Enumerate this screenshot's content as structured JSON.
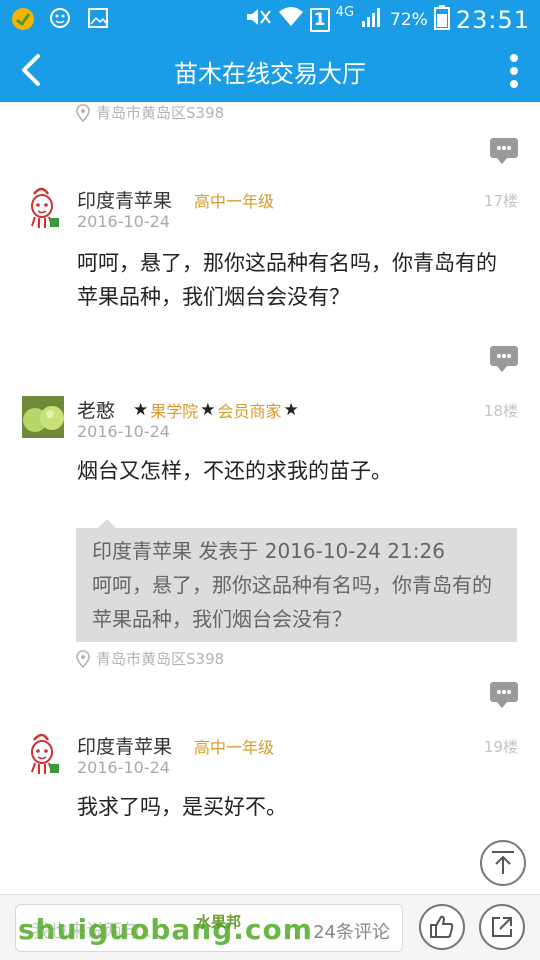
{
  "status_bar": {
    "network": "4G",
    "battery": "72%",
    "time": "23:51",
    "sim": "1"
  },
  "header": {
    "title": "苗木在线交易大厅"
  },
  "prev_post": {
    "location": "青岛市黄岛区S398"
  },
  "posts": [
    {
      "username": "印度青苹果",
      "level": "高中一年级",
      "floor": "17楼",
      "date": "2016-10-24",
      "text": "呵呵，悬了，那你这品种有名吗，你青岛有的苹果品种，我们烟台会没有？"
    },
    {
      "username": "老憨",
      "badge1": "果学院",
      "badge2": "会员商家",
      "floor": "18楼",
      "date": "2016-10-24",
      "text": "烟台又怎样，不还的求我的苗子。",
      "quote": {
        "header": "印度青苹果 发表于 2016-10-24 21:26",
        "text": "呵呵，悬了，那你这品种有名吗，你青岛有的苹果品种，我们烟台会没有？"
      },
      "location": "青岛市黄岛区S398"
    },
    {
      "username": "印度青苹果",
      "level": "高中一年级",
      "floor": "19楼",
      "date": "2016-10-24",
      "text": "我求了吗，是买好不。"
    }
  ],
  "bottom_bar": {
    "comment_placeholder": "我也来说两句...",
    "comment_count": "24条评论"
  },
  "watermark": {
    "domain": "shuiguobang.com",
    "brand": "水果邦"
  },
  "colors": {
    "accent": "#1a9ce6",
    "level": "#d79a2b"
  }
}
